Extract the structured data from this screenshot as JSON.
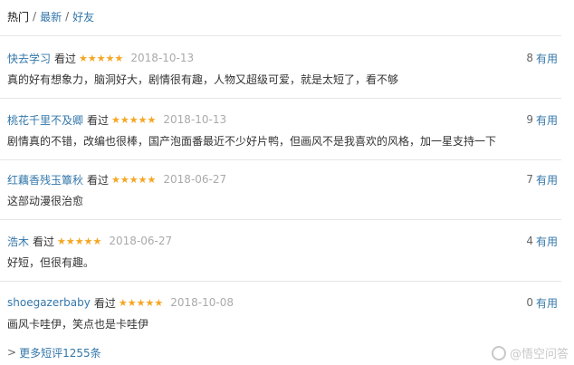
{
  "tabs": [
    "热门",
    "最新",
    "好友"
  ],
  "separator": "/",
  "watched_label": "看过",
  "useful_label": "有用",
  "reviews": [
    {
      "author": "快去学习",
      "stars": 5,
      "date": "2018-10-13",
      "useful": "8",
      "text": "真的好有想象力，脑洞好大，剧情很有趣，人物又超级可爱，就是太短了，看不够"
    },
    {
      "author": "桃花千里不及卿",
      "stars": 5,
      "date": "2018-10-13",
      "useful": "9",
      "text": "剧情真的不错，改编也很棒，国产泡面番最近不少好片鸭，但画风不是我喜欢的风格，加一星支持一下"
    },
    {
      "author": "红藕香残玉簟秋",
      "stars": 5,
      "date": "2018-06-27",
      "useful": "7",
      "text": "这部动漫很治愈"
    },
    {
      "author": "浩木",
      "stars": 5,
      "date": "2018-06-27",
      "useful": "4",
      "text": "好短，但很有趣。"
    },
    {
      "author": "shoegazerbaby",
      "stars": 5,
      "date": "2018-10-08",
      "useful": "0",
      "text": "画风卡哇伊，笑点也是卡哇伊"
    }
  ],
  "more_link": "更多短评1255条",
  "more_arrow": ">",
  "watermark": "@悟空问答",
  "colors": {
    "link": "#3377aa",
    "star": "#f5a623",
    "date": "#aaaaaa"
  }
}
